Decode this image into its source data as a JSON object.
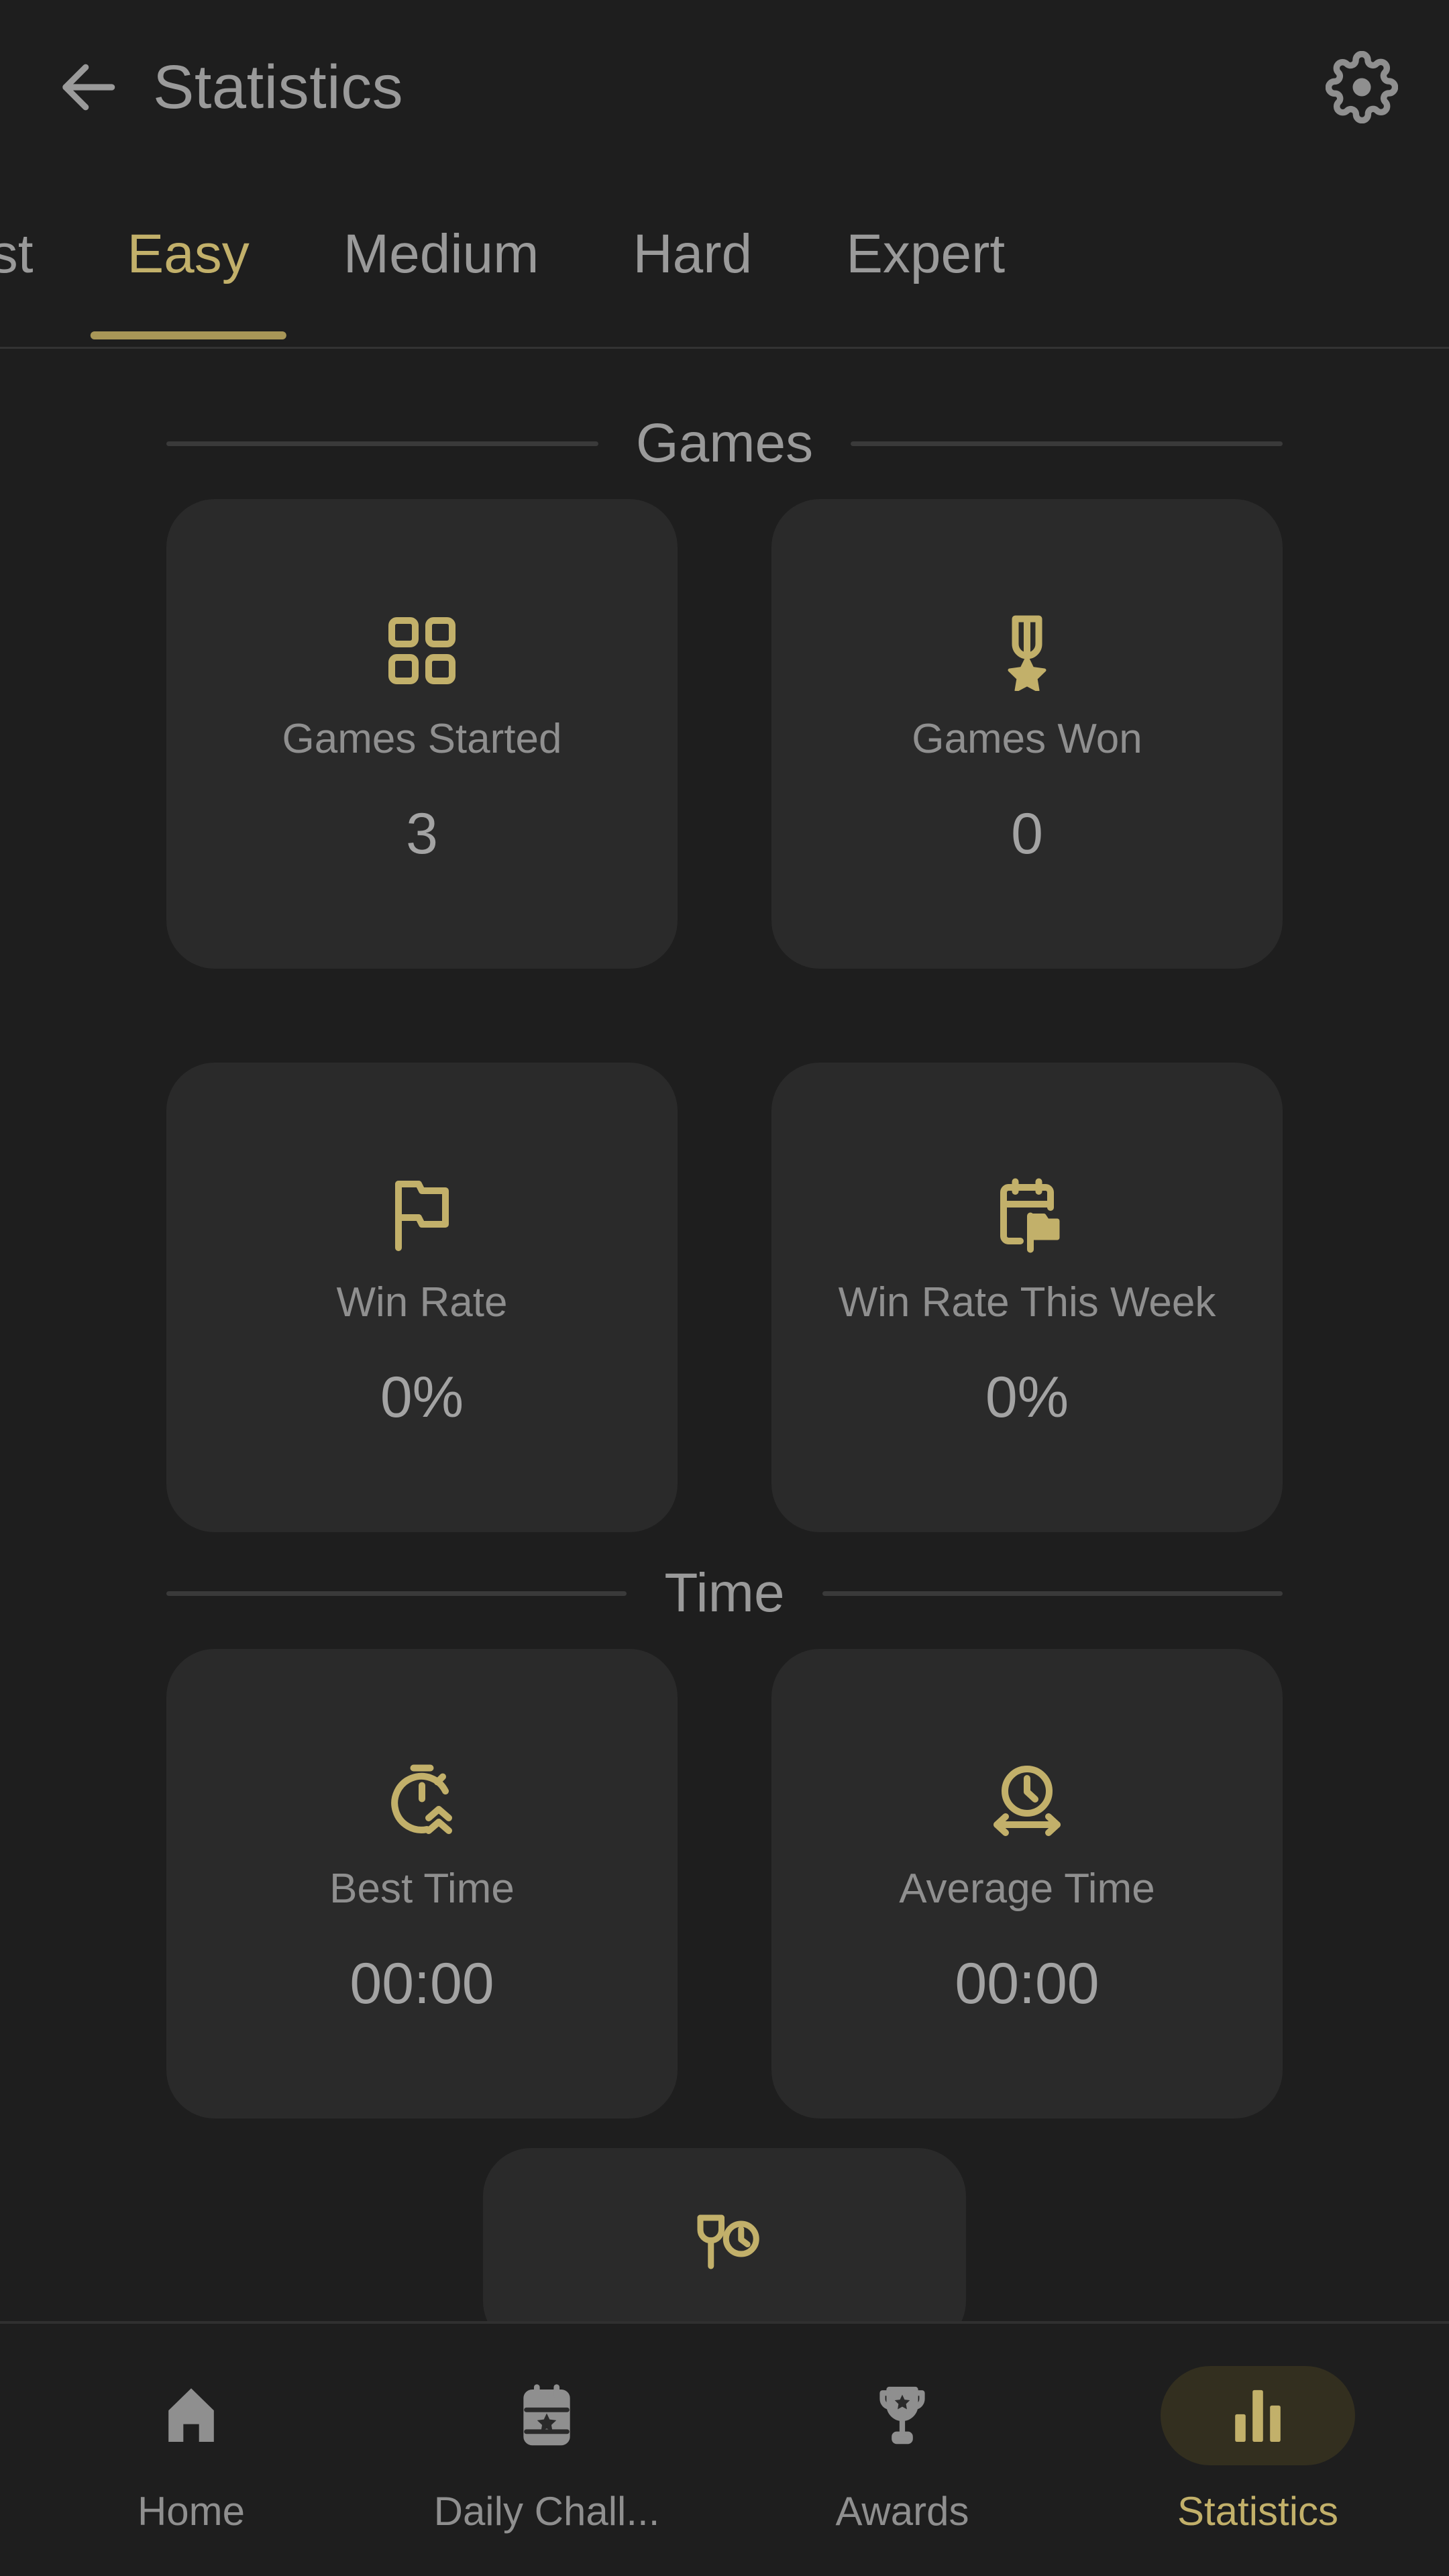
{
  "header": {
    "title": "Statistics",
    "back_icon": "arrow-left-icon",
    "settings_icon": "gear-icon"
  },
  "tabs": {
    "items": [
      {
        "label": "Fast",
        "active": false
      },
      {
        "label": "Easy",
        "active": true
      },
      {
        "label": "Medium",
        "active": false
      },
      {
        "label": "Hard",
        "active": false
      },
      {
        "label": "Expert",
        "active": false
      }
    ],
    "active_label": "Easy"
  },
  "sections": [
    {
      "title": "Games",
      "cards": [
        {
          "icon": "grid-squares-icon",
          "label": "Games Started",
          "value": "3"
        },
        {
          "icon": "medal-star-icon",
          "label": "Games Won",
          "value": "0"
        },
        {
          "icon": "flag-icon",
          "label": "Win Rate",
          "value": "0%"
        },
        {
          "icon": "calendar-flag-icon",
          "label": "Win Rate This Week",
          "value": "0%"
        }
      ]
    },
    {
      "title": "Time",
      "cards": [
        {
          "icon": "stopwatch-fast-icon",
          "label": "Best Time",
          "value": "00:00"
        },
        {
          "icon": "clock-arrows-icon",
          "label": "Average Time",
          "value": "00:00"
        }
      ]
    }
  ],
  "partial_card": {
    "icon": "hourglass-clock-icon"
  },
  "bottom_nav": {
    "items": [
      {
        "label": "Home",
        "icon": "home-icon",
        "active": false
      },
      {
        "label": "Daily Chall...",
        "icon": "calendar-star-icon",
        "active": false
      },
      {
        "label": "Awards",
        "icon": "trophy-icon",
        "active": false
      },
      {
        "label": "Statistics",
        "icon": "bar-chart-icon",
        "active": true
      }
    ]
  },
  "colors": {
    "accent_gold": "#c2b06a",
    "accent_gold_dim": "#a89657",
    "page_bg": "#1e1e1e",
    "card_bg": "#2a2a2a",
    "text_muted": "#8f8f8f",
    "text_value": "#a3a3a3",
    "active_pill_bg": "#332f1f"
  }
}
